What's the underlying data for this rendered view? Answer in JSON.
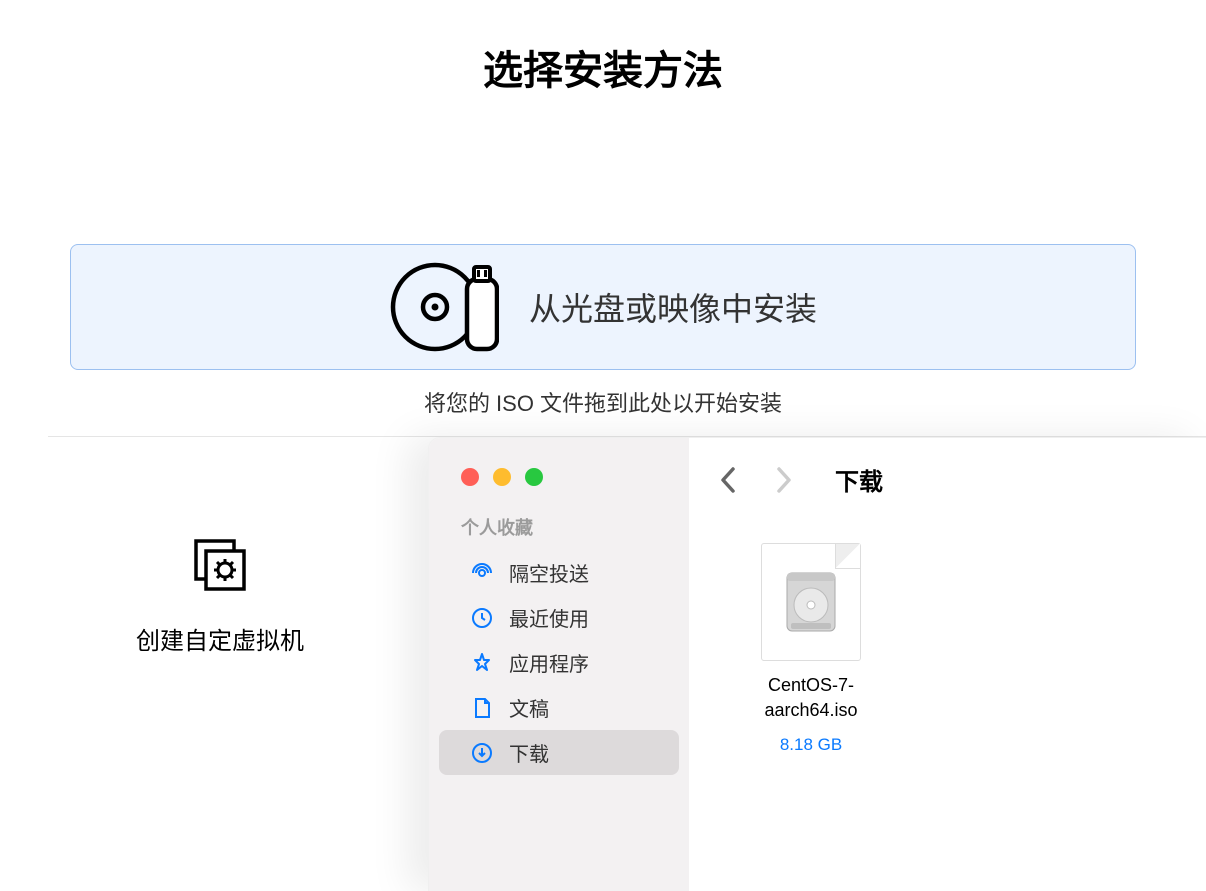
{
  "page_title": "选择安装方法",
  "install_option": {
    "label": "从光盘或映像中安装"
  },
  "hint": "将您的 ISO 文件拖到此处以开始安装",
  "custom_vm": {
    "label": "创建自定虚拟机"
  },
  "finder": {
    "sidebar_section": "个人收藏",
    "items": [
      {
        "label": "隔空投送"
      },
      {
        "label": "最近使用"
      },
      {
        "label": "应用程序"
      },
      {
        "label": "文稿"
      },
      {
        "label": "下载"
      }
    ],
    "location": "下载",
    "file": {
      "name_line1": "CentOS-7-",
      "name_line2": "aarch64.iso",
      "size": "8.18 GB"
    }
  }
}
